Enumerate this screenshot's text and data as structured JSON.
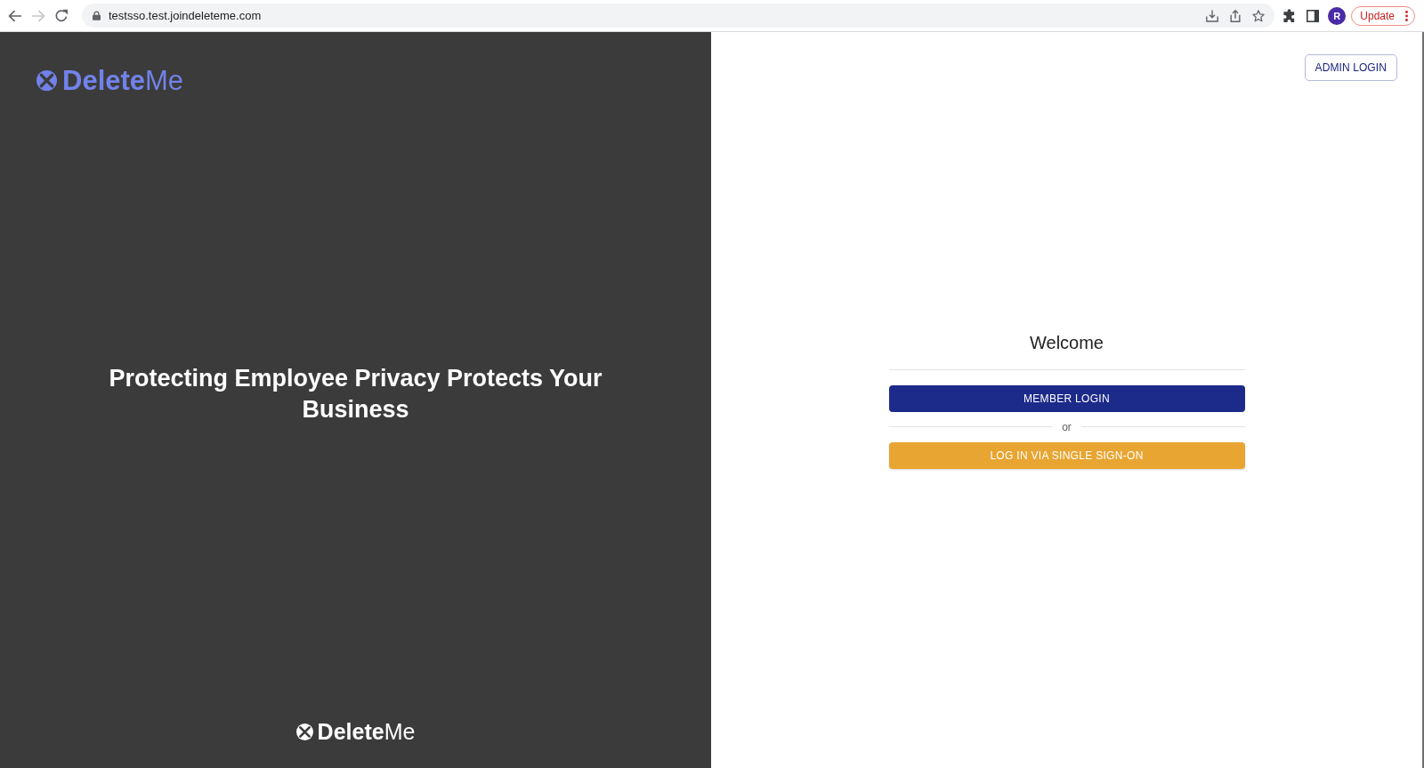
{
  "browser": {
    "forward_disabled": true,
    "url": "testsso.test.joindeleteme.com",
    "profile_initial": "R",
    "update_label": "Update"
  },
  "hero": {
    "logo": "**Delete**Me",
    "headline": "Protecting Employee Privacy Protects Your Business",
    "footer_logo": "**Delete**Me"
  },
  "login": {
    "admin_button": "ADMIN LOGIN",
    "title": "Welcome",
    "member_button": "MEMBER LOGIN",
    "separator": "or",
    "sso_button": "LOG IN VIA SINGLE SIGN-ON"
  }
}
